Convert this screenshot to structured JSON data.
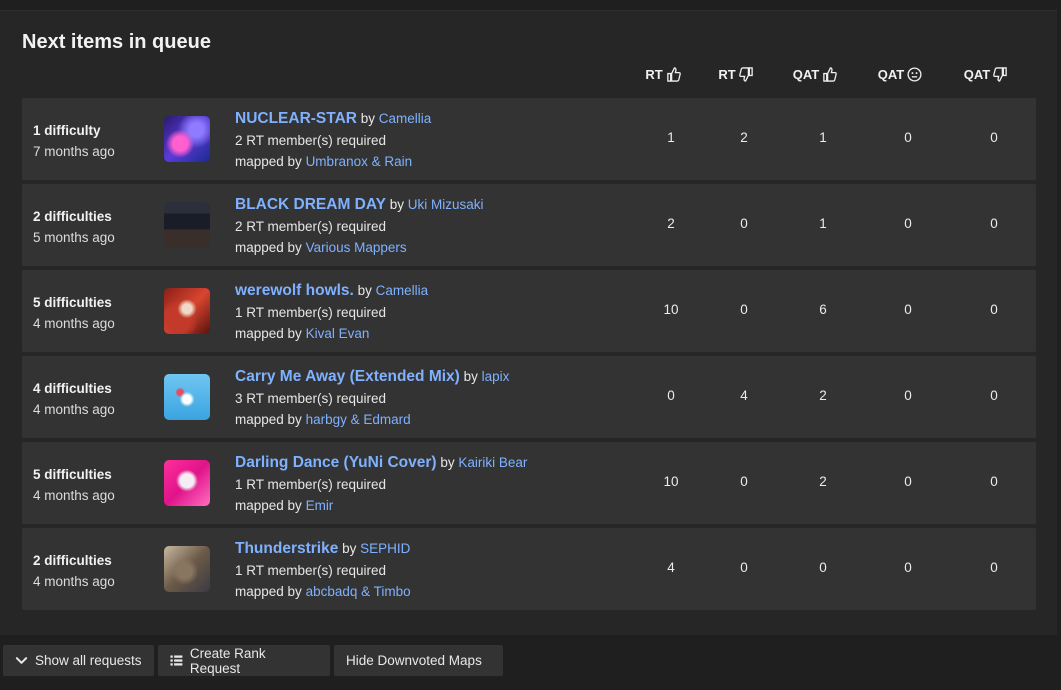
{
  "section_title": "Next items in queue",
  "columns": [
    {
      "label": "RT",
      "icon": "thumbs-up-icon"
    },
    {
      "label": "RT",
      "icon": "thumbs-down-icon"
    },
    {
      "label": "QAT",
      "icon": "thumbs-up-icon"
    },
    {
      "label": "QAT",
      "icon": "neutral-face-icon"
    },
    {
      "label": "QAT",
      "icon": "thumbs-down-icon"
    }
  ],
  "rows": [
    {
      "difficulty": "1 difficulty",
      "ago": "7 months ago",
      "song": "NUCLEAR-STAR",
      "by": "by",
      "artist": "Camellia",
      "required": "2 RT member(s) required",
      "mapped_prefix": "mapped by",
      "mappers": "Umbranox & Rain",
      "votes": [
        "1",
        "2",
        "1",
        "0",
        "0"
      ]
    },
    {
      "difficulty": "2 difficulties",
      "ago": "5 months ago",
      "song": "BLACK DREAM DAY",
      "by": "by",
      "artist": "Uki Mizusaki",
      "required": "2 RT member(s) required",
      "mapped_prefix": "mapped by",
      "mappers": "Various Mappers",
      "votes": [
        "2",
        "0",
        "1",
        "0",
        "0"
      ]
    },
    {
      "difficulty": "5 difficulties",
      "ago": "4 months ago",
      "song": "werewolf howls.",
      "by": "by",
      "artist": "Camellia",
      "required": "1 RT member(s) required",
      "mapped_prefix": "mapped by",
      "mappers": "Kival Evan",
      "votes": [
        "10",
        "0",
        "6",
        "0",
        "0"
      ]
    },
    {
      "difficulty": "4 difficulties",
      "ago": "4 months ago",
      "song": "Carry Me Away (Extended Mix)",
      "by": "by",
      "artist": "lapix",
      "required": "3 RT member(s) required",
      "mapped_prefix": "mapped by",
      "mappers": "harbgy & Edmard",
      "votes": [
        "0",
        "4",
        "2",
        "0",
        "0"
      ]
    },
    {
      "difficulty": "5 difficulties",
      "ago": "4 months ago",
      "song": "Darling Dance (YuNi Cover)",
      "by": "by",
      "artist": "Kairiki Bear",
      "required": "1 RT member(s) required",
      "mapped_prefix": "mapped by",
      "mappers": "Emir",
      "votes": [
        "10",
        "0",
        "2",
        "0",
        "0"
      ]
    },
    {
      "difficulty": "2 difficulties",
      "ago": "4 months ago",
      "song": "Thunderstrike",
      "by": "by",
      "artist": "SEPHID",
      "required": "1 RT member(s) required",
      "mapped_prefix": "mapped by",
      "mappers": "abcbadq & Timbo",
      "votes": [
        "4",
        "0",
        "0",
        "0",
        "0"
      ]
    }
  ],
  "buttons": {
    "show_all": "Show all requests",
    "create": "Create Rank Request",
    "hide": "Hide Downvoted Maps"
  },
  "colors": {
    "link": "#7fb1ff",
    "row_bg": "#333333",
    "panel_bg": "#262626",
    "page_bg": "#1f1f1f"
  }
}
